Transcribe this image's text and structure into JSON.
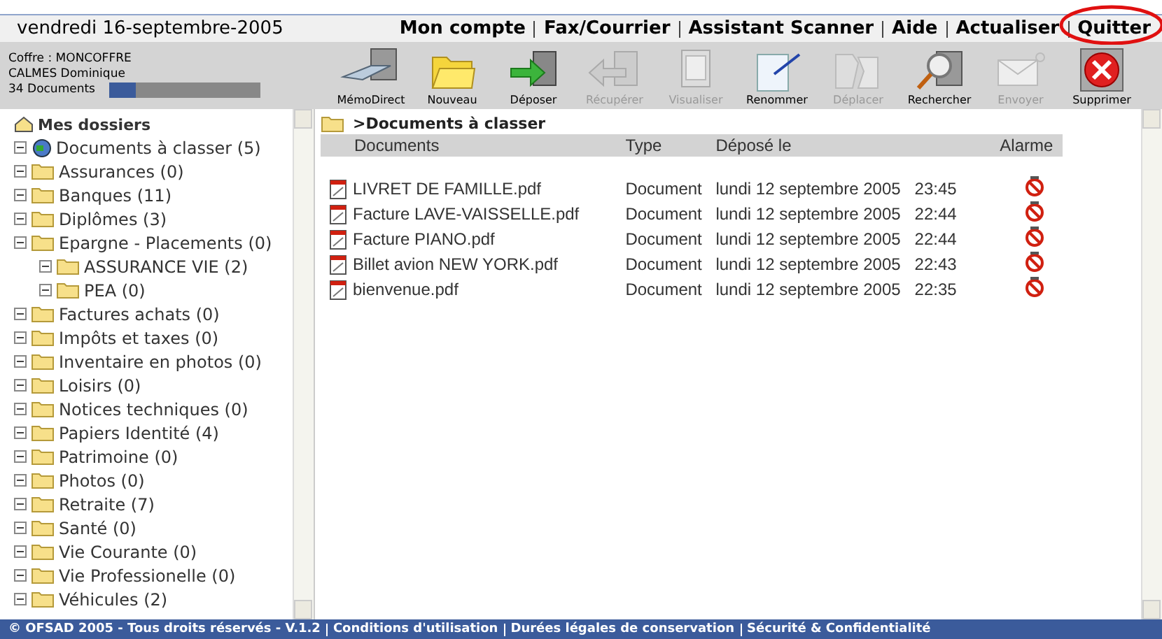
{
  "header": {
    "date": "vendredi 16-septembre-2005",
    "menu": [
      "Mon compte",
      "Fax/Courrier",
      "Assistant Scanner",
      "Aide",
      "Actualiser",
      "Quitter"
    ]
  },
  "account": {
    "vault": "Coffre : MONCOFFRE",
    "user": "CALMES Dominique",
    "documents": "34 Documents",
    "level": 0.18
  },
  "toolbar": [
    {
      "label": "MémoDirect",
      "kind": "keyboard",
      "disabled": false
    },
    {
      "label": "Nouveau",
      "kind": "folder",
      "disabled": false
    },
    {
      "label": "Déposer",
      "kind": "deposit",
      "disabled": false
    },
    {
      "label": "Récupérer",
      "kind": "retrieve",
      "disabled": true
    },
    {
      "label": "Visualiser",
      "kind": "view",
      "disabled": true
    },
    {
      "label": "Renommer",
      "kind": "rename",
      "disabled": false
    },
    {
      "label": "Déplacer",
      "kind": "move",
      "disabled": true
    },
    {
      "label": "Rechercher",
      "kind": "search",
      "disabled": false
    },
    {
      "label": "Envoyer",
      "kind": "mail",
      "disabled": true
    },
    {
      "label": "Supprimer",
      "kind": "delete",
      "disabled": false
    }
  ],
  "tree": {
    "root": "Mes dossiers",
    "items": [
      {
        "label": "Documents à classer (5)",
        "kind": "inbox",
        "expanded": true
      },
      {
        "label": "Assurances (0)",
        "kind": "folder",
        "expanded": true
      },
      {
        "label": "Banques (11)",
        "kind": "folder",
        "expanded": true
      },
      {
        "label": "Diplômes (3)",
        "kind": "folder",
        "expanded": true
      },
      {
        "label": "Epargne - Placements (0)",
        "kind": "folder",
        "expanded": true,
        "children": [
          {
            "label": "ASSURANCE VIE (2)",
            "kind": "folder",
            "expanded": true
          },
          {
            "label": "PEA (0)",
            "kind": "folder",
            "expanded": true
          }
        ]
      },
      {
        "label": "Factures achats (0)",
        "kind": "folder",
        "expanded": true
      },
      {
        "label": "Impôts et taxes (0)",
        "kind": "folder",
        "expanded": true
      },
      {
        "label": "Inventaire en photos (0)",
        "kind": "folder",
        "expanded": true
      },
      {
        "label": "Loisirs (0)",
        "kind": "folder",
        "expanded": true
      },
      {
        "label": "Notices techniques (0)",
        "kind": "folder",
        "expanded": true
      },
      {
        "label": "Papiers Identité (4)",
        "kind": "folder",
        "expanded": true
      },
      {
        "label": "Patrimoine (0)",
        "kind": "folder",
        "expanded": true
      },
      {
        "label": "Photos (0)",
        "kind": "folder",
        "expanded": true
      },
      {
        "label": "Retraite (7)",
        "kind": "folder",
        "expanded": true
      },
      {
        "label": "Santé (0)",
        "kind": "folder",
        "expanded": true
      },
      {
        "label": "Vie Courante (0)",
        "kind": "folder",
        "expanded": true
      },
      {
        "label": "Vie Professionelle (0)",
        "kind": "folder",
        "expanded": true
      },
      {
        "label": "Véhicules (2)",
        "kind": "folder",
        "expanded": true
      }
    ]
  },
  "content": {
    "path": ">Documents à classer",
    "table": {
      "columns": [
        "Documents",
        "Type",
        "Déposé le",
        "Alarme"
      ],
      "rows": [
        {
          "name": "LIVRET DE FAMILLE.pdf",
          "type": "Document",
          "date": "lundi 12 septembre 2005",
          "time": "23:45"
        },
        {
          "name": "Facture LAVE-VAISSELLE.pdf",
          "type": "Document",
          "date": "lundi 12 septembre 2005",
          "time": "22:44"
        },
        {
          "name": "Facture PIANO.pdf",
          "type": "Document",
          "date": "lundi 12 septembre 2005",
          "time": "22:44"
        },
        {
          "name": "Billet avion NEW YORK.pdf",
          "type": "Document",
          "date": "lundi 12 septembre 2005",
          "time": "22:43"
        },
        {
          "name": "bienvenue.pdf",
          "type": "Document",
          "date": "lundi 12 septembre 2005",
          "time": "22:35"
        }
      ]
    }
  },
  "footer": [
    "© OFSAD 2005 - Tous droits réservés - V.1.2",
    "Conditions d'utilisation",
    "Durées légales de conservation",
    "Sécurité & Confidentialité"
  ]
}
